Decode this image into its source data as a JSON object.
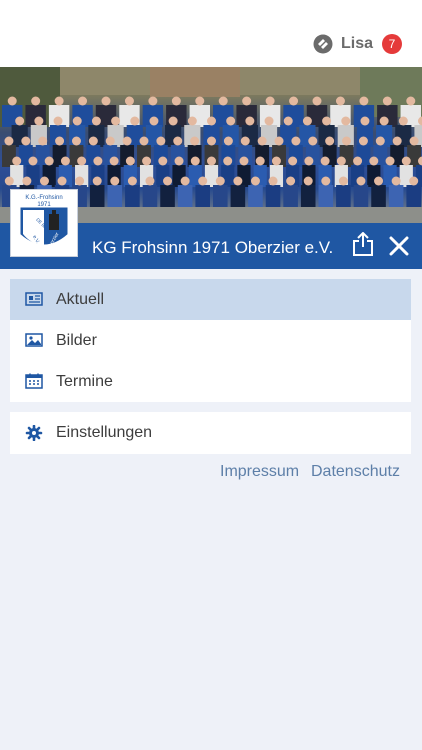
{
  "header": {
    "user_name": "Lisa",
    "notification_count": "7",
    "app_icon": "app-logo-icon"
  },
  "club": {
    "name": "KG Frohsinn 1971 Oberzier e.V.",
    "logo_text": {
      "line1": "K.G.-Frohsinn",
      "line2": "1971",
      "line3": "DE BAACH",
      "line4": "Oberzier",
      "line5": "e.V."
    },
    "share_icon": "share-icon",
    "close_icon": "close-icon"
  },
  "menu": {
    "items": [
      {
        "label": "Aktuell",
        "icon": "newspaper-icon",
        "active": true
      },
      {
        "label": "Bilder",
        "icon": "image-icon",
        "active": false
      },
      {
        "label": "Termine",
        "icon": "calendar-icon",
        "active": false
      }
    ],
    "settings": {
      "label": "Einstellungen",
      "icon": "gear-icon"
    }
  },
  "footer_links": {
    "impressum": "Impressum",
    "datenschutz": "Datenschutz"
  },
  "colors": {
    "accent_blue": "#1f57a3",
    "active_row": "#c8d8ec",
    "badge_red": "#e53a3a",
    "link_blue": "#5d7fa8",
    "background": "#eef1f8"
  }
}
